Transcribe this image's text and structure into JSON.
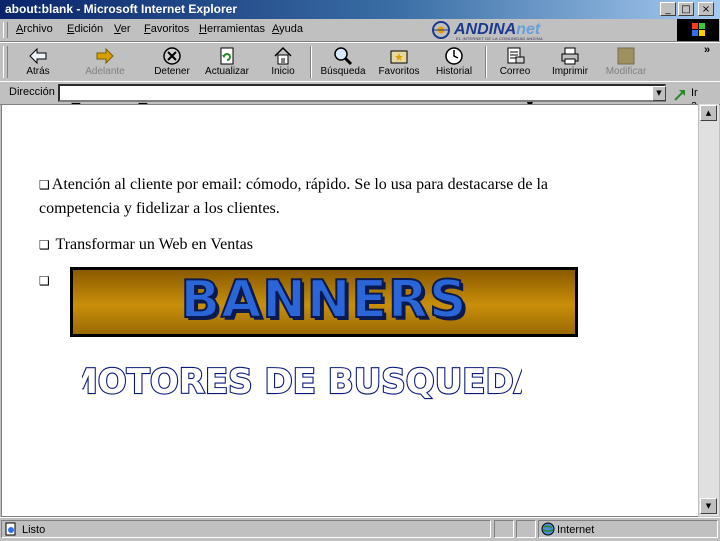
{
  "window": {
    "title": "about:blank - Microsoft Internet Explorer",
    "minimize_glyph": "_",
    "maximize_glyph": "□",
    "close_glyph": "×"
  },
  "menu": {
    "items": [
      "Archivo",
      "Edición",
      "Ver",
      "Favoritos",
      "Herramientas",
      "Ayuda"
    ]
  },
  "brand": {
    "name_main": "ANDINA",
    "name_sub": "net",
    "tagline": "EL INTERNET DE LA COMUNIDAD ANDINA"
  },
  "toolbar": {
    "back_label": "Atrás",
    "forward_label": "Adelante",
    "stop_label": "Detener",
    "refresh_label": "Actualizar",
    "home_label": "Inicio",
    "search_label": "Búsqueda",
    "favorites_label": "Favoritos",
    "history_label": "Historial",
    "mail_label": "Correo",
    "print_label": "Imprimir",
    "edit_label": "Modificar",
    "more_glyph": "»"
  },
  "address": {
    "label": "Dirección",
    "value": "",
    "go_label": "Ir a"
  },
  "content": {
    "para1": "Atención al cliente por email: cómodo, rápido. Se lo usa para destacarse de la competencia y fidelizar a los clientes.",
    "para2": "Transformar un Web en Ventas",
    "bullet_glyph": "❑",
    "banner_text": "BANNERS",
    "motores_text": "MOTORES DE BUSQUEDA"
  },
  "status": {
    "text": "Listo",
    "zone": "Internet"
  },
  "colors": {
    "title_start": "#0a246a",
    "title_end": "#a6caf0",
    "banner_fill": "#2a66d8",
    "banner_bg": "#c98f0a",
    "motores_fill": "#ffffff",
    "motores_stroke": "#0a1a7a"
  },
  "icons": [
    "back-icon",
    "forward-icon",
    "stop-icon",
    "refresh-icon",
    "home-icon",
    "search-icon",
    "favorites-icon",
    "history-icon",
    "mail-icon",
    "print-icon",
    "edit-icon",
    "go-arrow-icon",
    "page-icon",
    "globe-icon"
  ]
}
